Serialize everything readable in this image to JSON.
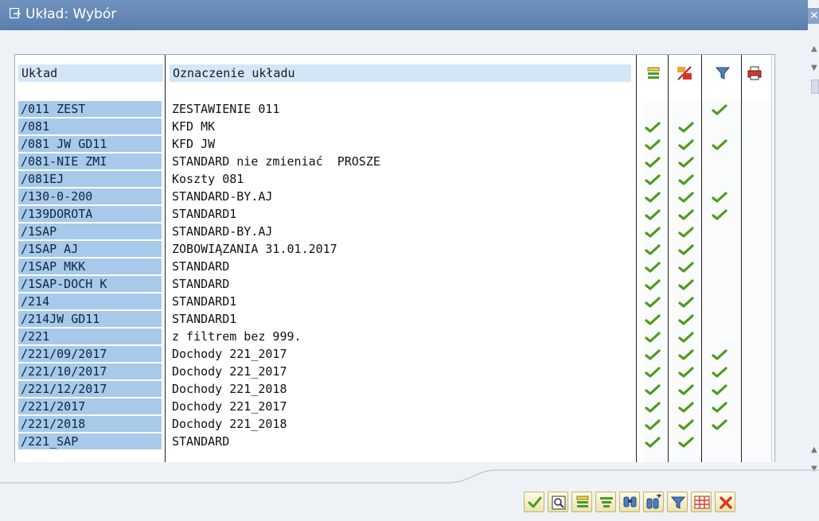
{
  "window": {
    "title": "Układ: Wybór",
    "close_glyph": "✕"
  },
  "columns": {
    "layout": "Układ",
    "description": "Oznaczenie układu",
    "icon_cols": [
      "default-layout-icon",
      "user-specific-icon",
      "filter-icon",
      "print-icon"
    ]
  },
  "rows": [
    {
      "layout": "/011 ZEST",
      "description": "ZESTAWIENIE 011",
      "checks": [
        false,
        false,
        true
      ]
    },
    {
      "layout": "/081",
      "description": "KFD MK",
      "checks": [
        true,
        true,
        false
      ]
    },
    {
      "layout": "/081 JW GD11",
      "description": "KFD JW",
      "checks": [
        true,
        true,
        true
      ]
    },
    {
      "layout": "/081-NIE ZMI",
      "description": "STANDARD nie zmieniać  PROSZE",
      "checks": [
        true,
        true,
        false
      ]
    },
    {
      "layout": "/081EJ",
      "description": "Koszty 081",
      "checks": [
        true,
        true,
        false
      ]
    },
    {
      "layout": "/130-0-200",
      "description": "STANDARD-BY.AJ",
      "checks": [
        true,
        true,
        true
      ]
    },
    {
      "layout": "/139DOROTA",
      "description": "STANDARD1",
      "checks": [
        true,
        true,
        true
      ]
    },
    {
      "layout": "/1SAP",
      "description": "STANDARD-BY.AJ",
      "checks": [
        true,
        true,
        false
      ]
    },
    {
      "layout": "/1SAP AJ",
      "description": "ZOBOWIĄZANIA 31.01.2017",
      "checks": [
        true,
        true,
        false
      ]
    },
    {
      "layout": "/1SAP MKK",
      "description": "STANDARD",
      "checks": [
        true,
        true,
        false
      ]
    },
    {
      "layout": "/1SAP-DOCH K",
      "description": "STANDARD",
      "checks": [
        true,
        true,
        false
      ]
    },
    {
      "layout": "/214",
      "description": "STANDARD1",
      "checks": [
        true,
        true,
        false
      ]
    },
    {
      "layout": "/214JW GD11",
      "description": "STANDARD1",
      "checks": [
        true,
        true,
        false
      ]
    },
    {
      "layout": "/221",
      "description": "z filtrem bez 999.",
      "checks": [
        true,
        true,
        false
      ]
    },
    {
      "layout": "/221/09/2017",
      "description": "Dochody 221_2017",
      "checks": [
        true,
        true,
        true
      ]
    },
    {
      "layout": "/221/10/2017",
      "description": "Dochody 221_2017",
      "checks": [
        true,
        true,
        true
      ]
    },
    {
      "layout": "/221/12/2017",
      "description": "Dochody 221_2018",
      "checks": [
        true,
        true,
        true
      ]
    },
    {
      "layout": "/221/2017",
      "description": "Dochody 221_2017",
      "checks": [
        true,
        true,
        true
      ]
    },
    {
      "layout": "/221/2018",
      "description": "Dochody 221_2018",
      "checks": [
        true,
        true,
        true
      ]
    },
    {
      "layout": "/221_SAP",
      "description": "STANDARD",
      "checks": [
        true,
        true,
        false
      ]
    }
  ],
  "toolbar": {
    "buttons": [
      "confirm-icon",
      "details-icon",
      "default-icon",
      "sort-icon",
      "find-icon",
      "find-next-icon",
      "filter-icon",
      "layout-grid-icon",
      "cancel-icon"
    ]
  },
  "colors": {
    "accent": "#5a7fad",
    "key_cell": "#a7c9ea",
    "header_cell": "#d3e6f8",
    "check": "#4f9a1e",
    "cancel": "#d83a1c"
  }
}
